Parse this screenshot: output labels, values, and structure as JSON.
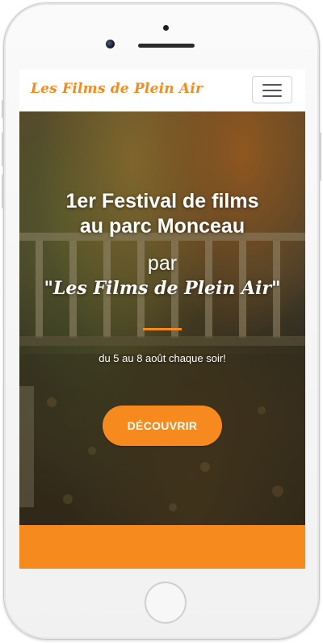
{
  "navbar": {
    "brand": "Les Films de Plein Air",
    "menu_icon": "hamburger-menu-icon"
  },
  "hero": {
    "title_line1": "1er Festival de films",
    "title_line2": "au parc Monceau",
    "par": "par",
    "brand_quote": "\"Les Films de Plein Air\"",
    "dates": "du 5 au 8 août chaque soir!",
    "cta_label": "DÉCOUVRIR",
    "background": "autumn-park-colonnade-photo"
  },
  "colors": {
    "accent": "#f68a1e",
    "white": "#ffffff"
  }
}
